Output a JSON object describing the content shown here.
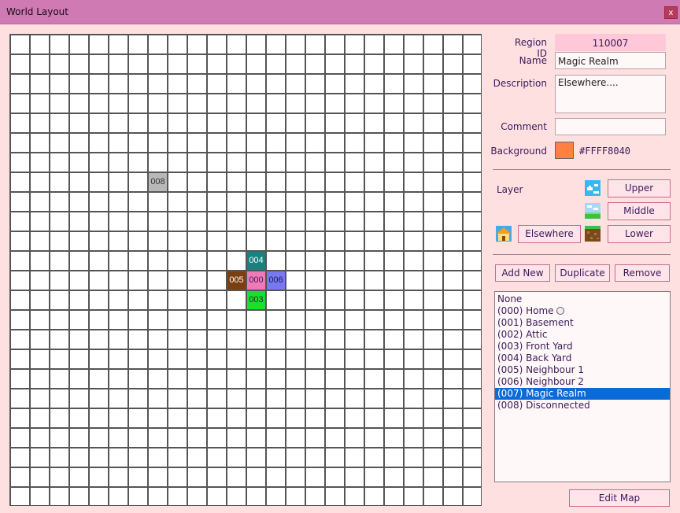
{
  "window": {
    "title": "World Layout",
    "close_label": "x"
  },
  "grid": {
    "columns": 24,
    "rows": 24,
    "cells": [
      {
        "label": "008",
        "col": 7,
        "row": 7,
        "color": "#b8b8b8",
        "text_color": "#333333"
      },
      {
        "label": "004",
        "col": 12,
        "row": 11,
        "color": "#1a8080",
        "text_color": "#ffffff"
      },
      {
        "label": "005",
        "col": 11,
        "row": 12,
        "color": "#7a4010",
        "text_color": "#ffffff"
      },
      {
        "label": "000",
        "col": 12,
        "row": 12,
        "color": "#f07ab8",
        "text_color": "#3a1a5a"
      },
      {
        "label": "006",
        "col": 13,
        "row": 12,
        "color": "#7878f0",
        "text_color": "#1a1a5a"
      },
      {
        "label": "003",
        "col": 12,
        "row": 13,
        "color": "#18e030",
        "text_color": "#1a3a1a"
      }
    ]
  },
  "props": {
    "region_id_label": "Region ID",
    "region_id_value": "110007",
    "name_label": "Name",
    "name_value": "Magic Realm",
    "description_label": "Description",
    "description_value": "Elsewhere....",
    "comment_label": "Comment",
    "comment_value": "",
    "background_label": "Background",
    "background_hex": "#FFFF8040",
    "background_color": "#ff8040"
  },
  "layer": {
    "label": "Layer",
    "upper_label": "Upper",
    "middle_label": "Middle",
    "lower_label": "Lower",
    "elsewhere_label": "Elsewhere",
    "icons": [
      "sky-icon",
      "grass-sky-icon",
      "dirt-icon",
      "house-icon"
    ]
  },
  "actions": {
    "add_new": "Add New",
    "duplicate": "Duplicate",
    "remove": "Remove",
    "edit_map": "Edit Map"
  },
  "regions": {
    "items": [
      "None",
      "(000) Home",
      "(001) Basement",
      "(002) Attic",
      "(003) Front Yard",
      "(004) Back Yard",
      "(005) Neighbour 1",
      "(006) Neighbour 2",
      "(007) Magic Realm",
      "(008) Disconnected"
    ],
    "selected_index": 8,
    "home_index": 1
  }
}
